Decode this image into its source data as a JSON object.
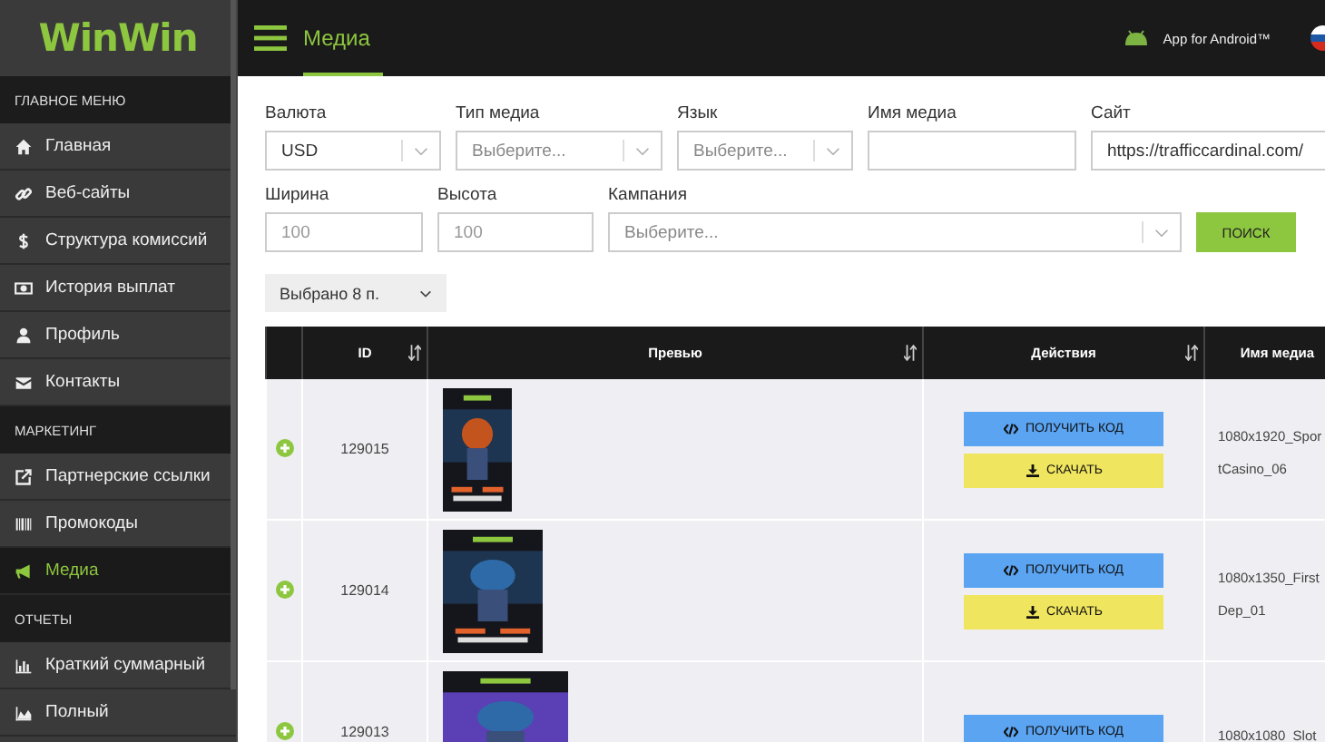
{
  "logo": {
    "text": "WinWin"
  },
  "sidebar": {
    "sections": [
      {
        "title": "ГЛАВНОЕ МЕНЮ",
        "items": [
          {
            "label": "Главная",
            "selected": false
          },
          {
            "label": "Веб-сайты",
            "selected": false
          },
          {
            "label": "Структура комиссий",
            "selected": false
          },
          {
            "label": "История выплат",
            "selected": false
          },
          {
            "label": "Профиль",
            "selected": false
          },
          {
            "label": "Контакты",
            "selected": false
          }
        ]
      },
      {
        "title": "МАРКЕТИНГ",
        "items": [
          {
            "label": "Партнерские ссылки",
            "selected": false
          },
          {
            "label": "Промокоды",
            "selected": false
          },
          {
            "label": "Медиа",
            "selected": true
          }
        ]
      },
      {
        "title": "ОТЧЕТЫ",
        "items": [
          {
            "label": "Краткий суммарный",
            "selected": false
          },
          {
            "label": "Полный",
            "selected": false
          }
        ]
      }
    ]
  },
  "header": {
    "title": "Медиа",
    "app_link": "App for Android™"
  },
  "filters": [
    {
      "label": "Валюта",
      "kind": "select",
      "value": "USD"
    },
    {
      "label": "Тип медиа",
      "kind": "select",
      "placeholder": "Выберите..."
    },
    {
      "label": "Язык",
      "kind": "select",
      "placeholder": "Выберите..."
    },
    {
      "label": "Имя медиа",
      "kind": "input"
    },
    {
      "label": "Сайт",
      "kind": "input",
      "value": "https://trafficcardinal.com/"
    },
    {
      "label": "Ширина",
      "kind": "input",
      "placeholder": "100"
    },
    {
      "label": "Высота",
      "kind": "input",
      "placeholder": "100"
    },
    {
      "label": "Кампания",
      "kind": "select",
      "placeholder": "Выберите..."
    },
    {
      "kind": "button",
      "label": "ПОИСК"
    }
  ],
  "selected_count": "Выбрано 8 п.",
  "table": {
    "columns": [
      {
        "label": "ID",
        "sortable": true
      },
      {
        "label": "Превью",
        "sortable": true
      },
      {
        "label": "Действия",
        "sortable": true
      },
      {
        "label": "Имя медиа"
      }
    ],
    "rows": [
      {
        "id": "129015",
        "preview": {
          "kind": "picture"
        },
        "buttons": [
          {
            "label": "ПОЛУЧИТЬ КОД",
            "kind": "code"
          },
          {
            "label": "СКАЧАТЬ",
            "kind": "download"
          }
        ],
        "name": "1080x1920_Spor",
        "name_2": "tCasino_06"
      },
      {
        "id": "129014",
        "preview": {
          "kind": "picture"
        },
        "buttons": [
          {
            "label": "ПОЛУЧИТЬ КОД",
            "kind": "code"
          },
          {
            "label": "СКАЧАТЬ",
            "kind": "download"
          }
        ],
        "name": "1080x1350_First",
        "name_2": "Dep_01"
      },
      {
        "id": "129013",
        "preview": {
          "kind": "picture"
        },
        "buttons": [
          {
            "label": "ПОЛУЧИТЬ КОД",
            "kind": "code"
          }
        ],
        "name": "1080x1080_Slot"
      }
    ]
  }
}
